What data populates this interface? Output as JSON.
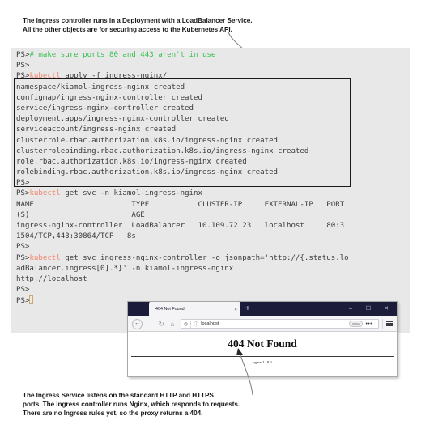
{
  "annotations": {
    "top": "The ingress controller runs in a Deployment with a LoadBalancer Service.\nAll the other objects are for securing access to the Kubernetes API.",
    "bottom": "The Ingress Service listens on the standard HTTP and HTTPS\nports. The ingress controller runs Nginx, which responds to requests.\nThere are no Ingress rules yet, so the proxy returns a 404."
  },
  "terminal": {
    "prompt": "PS>",
    "colors": {
      "background": "#e8e8e8",
      "text": "#3b3b3b",
      "command": "#f2836b",
      "comment": "#34c24b",
      "cursor": "#c8a878"
    },
    "lines": [
      {
        "prompt": "PS>",
        "comment": "# make sure ports 80 and 443 aren't in use"
      },
      {
        "prompt": "PS>"
      },
      {
        "prompt": "PS>",
        "cmd": "kubectl",
        "rest": " apply -f ingress-nginx/"
      },
      {
        "text": "namespace/kiamol-ingress-nginx created"
      },
      {
        "text": "configmap/ingress-nginx-controller created"
      },
      {
        "text": "service/ingress-nginx-controller created"
      },
      {
        "text": "deployment.apps/ingress-nginx-controller created"
      },
      {
        "text": "serviceaccount/ingress-nginx created"
      },
      {
        "text": "clusterrole.rbac.authorization.k8s.io/ingress-nginx created"
      },
      {
        "text": "clusterrolebinding.rbac.authorization.k8s.io/ingress-nginx created"
      },
      {
        "text": "role.rbac.authorization.k8s.io/ingress-nginx created"
      },
      {
        "text": "rolebinding.rbac.authorization.k8s.io/ingress-nginx created"
      },
      {
        "prompt": "PS>"
      },
      {
        "prompt": "PS>",
        "cmd": "kubectl",
        "rest": " get svc -n kiamol-ingress-nginx"
      },
      {
        "text": "NAME                      TYPE           CLUSTER-IP     EXTERNAL-IP   PORT"
      },
      {
        "text": "(S)                       AGE"
      },
      {
        "text": "ingress-nginx-controller  LoadBalancer   10.109.72.23   localhost     80:3"
      },
      {
        "text": "1504/TCP,443:30864/TCP   8s"
      },
      {
        "prompt": "PS>"
      },
      {
        "prompt": "PS>",
        "cmd": "kubectl",
        "rest": " get svc ingress-nginx-controller -o jsonpath='http://{.status.lo"
      },
      {
        "text": "adBalancer.ingress[0].*}' -n kiamol-ingress-nginx"
      },
      {
        "text": "http://localhost"
      },
      {
        "prompt": "PS>"
      },
      {
        "prompt": "PS>",
        "cursor": true
      }
    ]
  },
  "browser": {
    "tab": {
      "title": "404 Not Found",
      "close_label": "×"
    },
    "new_tab_label": "+",
    "window_controls": {
      "minimize": "–",
      "maximize": "☐",
      "close": "✕"
    },
    "toolbar": {
      "back_label": "←",
      "forward_label": "→",
      "reload_label": "↻",
      "home_label": "⌂",
      "url": "localhost",
      "zoom": "80%",
      "page_actions_label": "•••"
    },
    "page": {
      "heading": "404 Not Found",
      "server": "nginx/1.19.0"
    }
  }
}
